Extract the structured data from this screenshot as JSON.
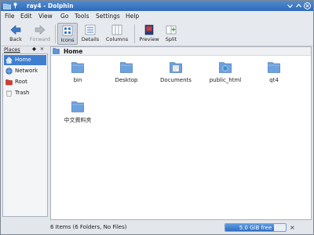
{
  "window": {
    "title": "ray4 - Dolphin"
  },
  "menubar": {
    "items": [
      {
        "label": "File"
      },
      {
        "label": "Edit"
      },
      {
        "label": "View"
      },
      {
        "label": "Go"
      },
      {
        "label": "Tools"
      },
      {
        "label": "Settings"
      },
      {
        "label": "Help"
      }
    ]
  },
  "toolbar": {
    "back": "Back",
    "forward": "Forward",
    "icons": "Icons",
    "details": "Details",
    "columns": "Columns",
    "preview": "Preview",
    "split": "Split"
  },
  "places": {
    "title": "Places",
    "items": [
      {
        "label": "Home",
        "icon": "home-icon",
        "selected": true
      },
      {
        "label": "Network",
        "icon": "network-icon"
      },
      {
        "label": "Root",
        "icon": "root-folder-icon"
      },
      {
        "label": "Trash",
        "icon": "trash-icon"
      }
    ]
  },
  "view": {
    "location": "Home",
    "files": [
      {
        "name": "bin",
        "icon": "folder-icon"
      },
      {
        "name": "Desktop",
        "icon": "folder-icon"
      },
      {
        "name": "Documents",
        "icon": "documents-folder-icon"
      },
      {
        "name": "public_html",
        "icon": "html-folder-icon"
      },
      {
        "name": "qt4",
        "icon": "folder-icon"
      },
      {
        "name": "中文資料夾",
        "icon": "folder-icon"
      }
    ]
  },
  "status": {
    "text": "6 Items (6 Folders, No Files)",
    "free_space": "5.0 GiB free",
    "used_fraction": 0.8
  },
  "colors": {
    "accent": "#3e7fd0",
    "titlebar": "#3a76c2",
    "folder": "#5b95d6"
  }
}
